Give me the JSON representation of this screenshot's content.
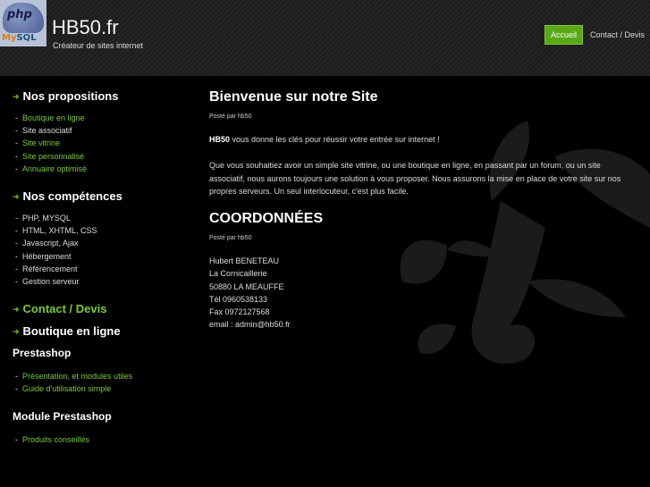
{
  "header": {
    "title": "HB50.fr",
    "tagline": "Créateur de sites internet",
    "logo": {
      "php": "php",
      "mysql_my": "My",
      "mysql_sql": "SQL"
    },
    "nav": [
      {
        "label": "Accueil",
        "active": true
      },
      {
        "label": "Contact / Devis",
        "active": false
      }
    ]
  },
  "sidebar": {
    "propositions": {
      "title": "Nos propositions",
      "items": [
        "Boutique en ligne",
        "Site associatif",
        "Site vitrine",
        "Site personnalisé",
        "Annuaire optimisé"
      ]
    },
    "competences": {
      "title": "Nos compétences",
      "items": [
        "PHP, MYSQL",
        "HTML, XHTML, CSS",
        "Javascript, Ajax",
        "Hébergement",
        "Référencement",
        "Gestion serveur"
      ]
    },
    "contact_link": "Contact / Devis",
    "boutique_link": "Boutique en ligne",
    "prestashop": {
      "title": "Prestashop",
      "items": [
        "Présentation, et modules utiles",
        "Guide d'utilisation simple"
      ]
    },
    "module_prestashop": {
      "title": "Module Prestashop",
      "items": [
        "Produits conseillés"
      ]
    }
  },
  "main": {
    "welcome_title": "Bienvenue sur notre Site",
    "welcome_posted": "Posté par hb50",
    "intro_bold": "HB50",
    "intro_rest": " vous donne les clés pour réussir votre entrée sur internet !",
    "body": "Que vous souhaitiez avoir un simple site vitrine, ou une boutique en ligne, en passant par un forum, ou un site associatif, nous aurons toujours une solution à vous proposer. Nous assurons la mise en place de votre site sur nos propres serveurs. Un seul interlocuteur, c'est plus facile.",
    "coord_title": "COORDONNÉES",
    "coord_posted": "Posté par hb50",
    "address": [
      "Hubert BENETEAU",
      "La Cornicaillerie",
      "50880 LA MEAUFFE",
      "Tél 0960538133",
      "Fax 0972127568",
      "email : admin@hb50.fr"
    ]
  },
  "colors": {
    "accent": "#5aa816",
    "link": "#7cc83a",
    "background": "#000000"
  }
}
